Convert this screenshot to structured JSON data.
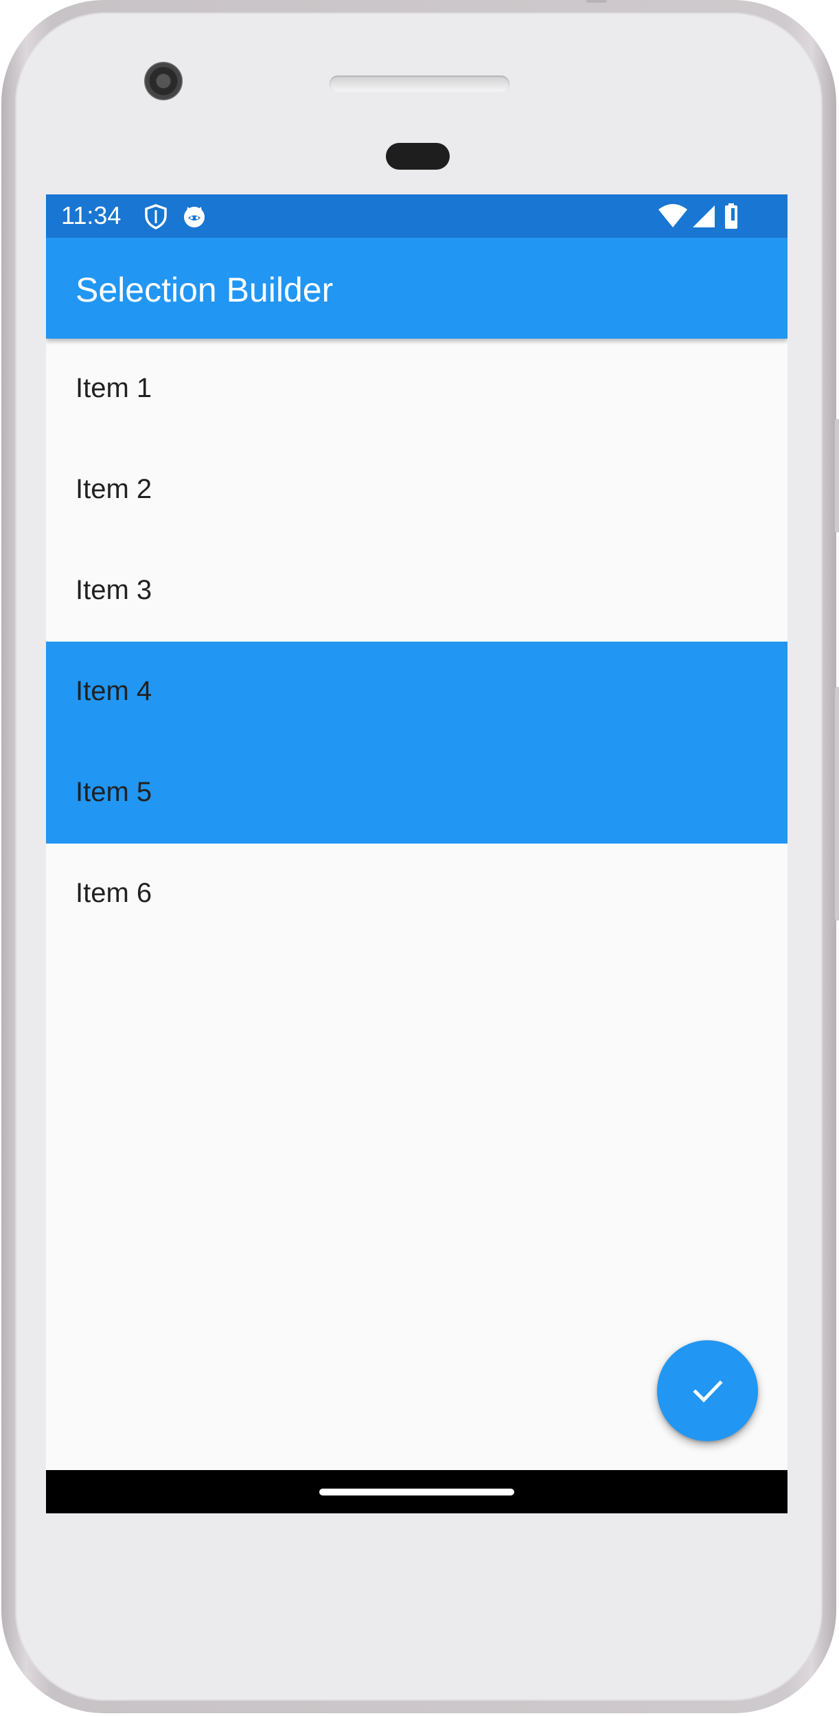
{
  "status_bar": {
    "time": "11:34",
    "icons_left": [
      "shield-icon",
      "cat-face-icon"
    ],
    "icons_right": [
      "wifi-icon",
      "cell-signal-icon",
      "battery-icon"
    ],
    "color": "#1976d2"
  },
  "app_bar": {
    "title": "Selection Builder",
    "color": "#2196f3"
  },
  "list": {
    "items": [
      {
        "label": "Item 1",
        "selected": false
      },
      {
        "label": "Item 2",
        "selected": false
      },
      {
        "label": "Item 3",
        "selected": false
      },
      {
        "label": "Item 4",
        "selected": true
      },
      {
        "label": "Item 5",
        "selected": true
      },
      {
        "label": "Item 6",
        "selected": false
      }
    ],
    "selected_color": "#2196f3"
  },
  "fab": {
    "icon": "check-icon",
    "color": "#2196f3"
  },
  "nav_bar": {
    "color": "#000000"
  }
}
